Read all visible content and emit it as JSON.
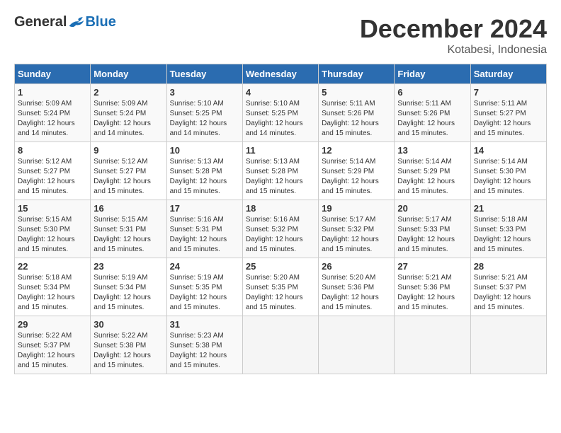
{
  "logo": {
    "general": "General",
    "blue": "Blue"
  },
  "title": {
    "month_year": "December 2024",
    "location": "Kotabesi, Indonesia"
  },
  "headers": [
    "Sunday",
    "Monday",
    "Tuesday",
    "Wednesday",
    "Thursday",
    "Friday",
    "Saturday"
  ],
  "weeks": [
    [
      {
        "day": "1",
        "sunrise": "5:09 AM",
        "sunset": "5:24 PM",
        "daylight": "12 hours and 14 minutes."
      },
      {
        "day": "2",
        "sunrise": "5:09 AM",
        "sunset": "5:24 PM",
        "daylight": "12 hours and 14 minutes."
      },
      {
        "day": "3",
        "sunrise": "5:10 AM",
        "sunset": "5:25 PM",
        "daylight": "12 hours and 14 minutes."
      },
      {
        "day": "4",
        "sunrise": "5:10 AM",
        "sunset": "5:25 PM",
        "daylight": "12 hours and 14 minutes."
      },
      {
        "day": "5",
        "sunrise": "5:11 AM",
        "sunset": "5:26 PM",
        "daylight": "12 hours and 15 minutes."
      },
      {
        "day": "6",
        "sunrise": "5:11 AM",
        "sunset": "5:26 PM",
        "daylight": "12 hours and 15 minutes."
      },
      {
        "day": "7",
        "sunrise": "5:11 AM",
        "sunset": "5:27 PM",
        "daylight": "12 hours and 15 minutes."
      }
    ],
    [
      {
        "day": "8",
        "sunrise": "5:12 AM",
        "sunset": "5:27 PM",
        "daylight": "12 hours and 15 minutes."
      },
      {
        "day": "9",
        "sunrise": "5:12 AM",
        "sunset": "5:27 PM",
        "daylight": "12 hours and 15 minutes."
      },
      {
        "day": "10",
        "sunrise": "5:13 AM",
        "sunset": "5:28 PM",
        "daylight": "12 hours and 15 minutes."
      },
      {
        "day": "11",
        "sunrise": "5:13 AM",
        "sunset": "5:28 PM",
        "daylight": "12 hours and 15 minutes."
      },
      {
        "day": "12",
        "sunrise": "5:14 AM",
        "sunset": "5:29 PM",
        "daylight": "12 hours and 15 minutes."
      },
      {
        "day": "13",
        "sunrise": "5:14 AM",
        "sunset": "5:29 PM",
        "daylight": "12 hours and 15 minutes."
      },
      {
        "day": "14",
        "sunrise": "5:14 AM",
        "sunset": "5:30 PM",
        "daylight": "12 hours and 15 minutes."
      }
    ],
    [
      {
        "day": "15",
        "sunrise": "5:15 AM",
        "sunset": "5:30 PM",
        "daylight": "12 hours and 15 minutes."
      },
      {
        "day": "16",
        "sunrise": "5:15 AM",
        "sunset": "5:31 PM",
        "daylight": "12 hours and 15 minutes."
      },
      {
        "day": "17",
        "sunrise": "5:16 AM",
        "sunset": "5:31 PM",
        "daylight": "12 hours and 15 minutes."
      },
      {
        "day": "18",
        "sunrise": "5:16 AM",
        "sunset": "5:32 PM",
        "daylight": "12 hours and 15 minutes."
      },
      {
        "day": "19",
        "sunrise": "5:17 AM",
        "sunset": "5:32 PM",
        "daylight": "12 hours and 15 minutes."
      },
      {
        "day": "20",
        "sunrise": "5:17 AM",
        "sunset": "5:33 PM",
        "daylight": "12 hours and 15 minutes."
      },
      {
        "day": "21",
        "sunrise": "5:18 AM",
        "sunset": "5:33 PM",
        "daylight": "12 hours and 15 minutes."
      }
    ],
    [
      {
        "day": "22",
        "sunrise": "5:18 AM",
        "sunset": "5:34 PM",
        "daylight": "12 hours and 15 minutes."
      },
      {
        "day": "23",
        "sunrise": "5:19 AM",
        "sunset": "5:34 PM",
        "daylight": "12 hours and 15 minutes."
      },
      {
        "day": "24",
        "sunrise": "5:19 AM",
        "sunset": "5:35 PM",
        "daylight": "12 hours and 15 minutes."
      },
      {
        "day": "25",
        "sunrise": "5:20 AM",
        "sunset": "5:35 PM",
        "daylight": "12 hours and 15 minutes."
      },
      {
        "day": "26",
        "sunrise": "5:20 AM",
        "sunset": "5:36 PM",
        "daylight": "12 hours and 15 minutes."
      },
      {
        "day": "27",
        "sunrise": "5:21 AM",
        "sunset": "5:36 PM",
        "daylight": "12 hours and 15 minutes."
      },
      {
        "day": "28",
        "sunrise": "5:21 AM",
        "sunset": "5:37 PM",
        "daylight": "12 hours and 15 minutes."
      }
    ],
    [
      {
        "day": "29",
        "sunrise": "5:22 AM",
        "sunset": "5:37 PM",
        "daylight": "12 hours and 15 minutes."
      },
      {
        "day": "30",
        "sunrise": "5:22 AM",
        "sunset": "5:38 PM",
        "daylight": "12 hours and 15 minutes."
      },
      {
        "day": "31",
        "sunrise": "5:23 AM",
        "sunset": "5:38 PM",
        "daylight": "12 hours and 15 minutes."
      },
      null,
      null,
      null,
      null
    ]
  ],
  "labels": {
    "sunrise": "Sunrise:",
    "sunset": "Sunset:",
    "daylight": "Daylight:"
  }
}
